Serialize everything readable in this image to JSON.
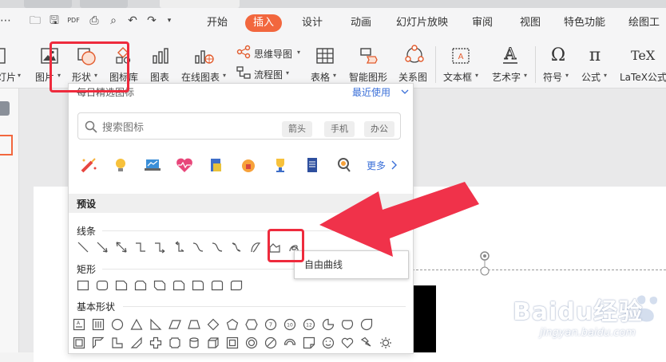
{
  "menu": {
    "tabs": [
      "开始",
      "插入",
      "设计",
      "动画",
      "幻灯片放映",
      "审阅",
      "视图",
      "特色功能",
      "绘图工具"
    ],
    "active_tab": "插入",
    "accent": "#f2673e"
  },
  "ribbon": {
    "items": [
      {
        "id": "slide",
        "label": "灯片"
      },
      {
        "id": "picture",
        "label": "图片"
      },
      {
        "id": "shapes",
        "label": "形状"
      },
      {
        "id": "iconlib",
        "label": "图标库"
      },
      {
        "id": "chart",
        "label": "图表"
      },
      {
        "id": "online-chart",
        "label": "在线图表"
      },
      {
        "id": "mindmap",
        "label": "思维导图"
      },
      {
        "id": "flowchart",
        "label": "流程图"
      },
      {
        "id": "table",
        "label": "表格"
      },
      {
        "id": "smartart",
        "label": "智能图形"
      },
      {
        "id": "relation",
        "label": "关系图"
      },
      {
        "id": "textbox",
        "label": "文本框"
      },
      {
        "id": "wordart",
        "label": "艺术字"
      },
      {
        "id": "symbol",
        "label": "符号"
      },
      {
        "id": "formula",
        "label": "公式"
      },
      {
        "id": "latex",
        "label": "LaTeX公式"
      }
    ],
    "latex_glyph": "TeX"
  },
  "panel": {
    "header": "每日精选图标",
    "recent": "最近使用",
    "search_placeholder": "搜索图标",
    "tags": [
      "箭头",
      "手机",
      "办公"
    ],
    "more": "更多",
    "preset": "预设",
    "sections": {
      "lines": "线条",
      "rect": "矩形",
      "basic": "基本形状"
    }
  },
  "tooltip": "自由曲线",
  "watermark": {
    "brand": "Baidu经验",
    "url": "jingyan.baidu.com"
  },
  "colors": {
    "highlight": "#ee2b3d",
    "arrow": "#f0324a"
  }
}
